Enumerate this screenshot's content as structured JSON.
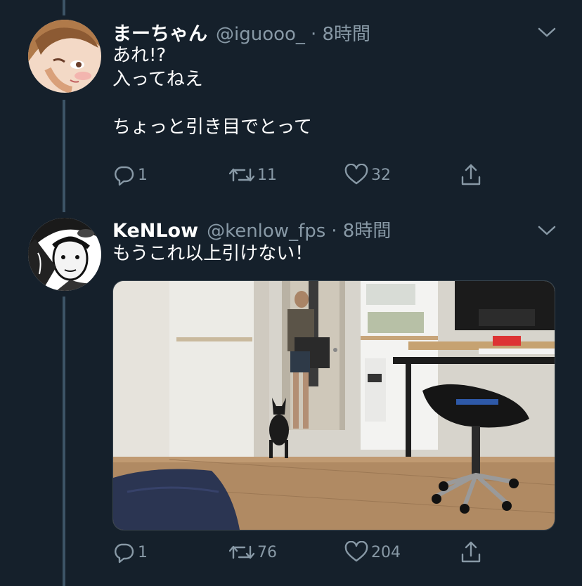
{
  "tweets": [
    {
      "display_name": "まーちゃん",
      "handle": "@iguooo_",
      "time": "· 8時間",
      "lines": [
        "あれ!?",
        "入ってねえ",
        "",
        "ちょっと引き目でとって"
      ],
      "reply_count": "1",
      "retweet_count": "11",
      "like_count": "32"
    },
    {
      "display_name": "KeNLow",
      "handle": "@kenlow_fps",
      "time": "· 8時間",
      "lines": [
        "もうこれ以上引けない！"
      ],
      "reply_count": "1",
      "retweet_count": "76",
      "like_count": "204"
    }
  ],
  "colors": {
    "background": "#15202b",
    "secondary_text": "#8899a6",
    "thread_line": "#3d5466"
  },
  "icons": {
    "reply": "reply-icon",
    "retweet": "retweet-icon",
    "like": "like-icon",
    "share": "share-icon",
    "menu": "chevron-down-icon"
  }
}
